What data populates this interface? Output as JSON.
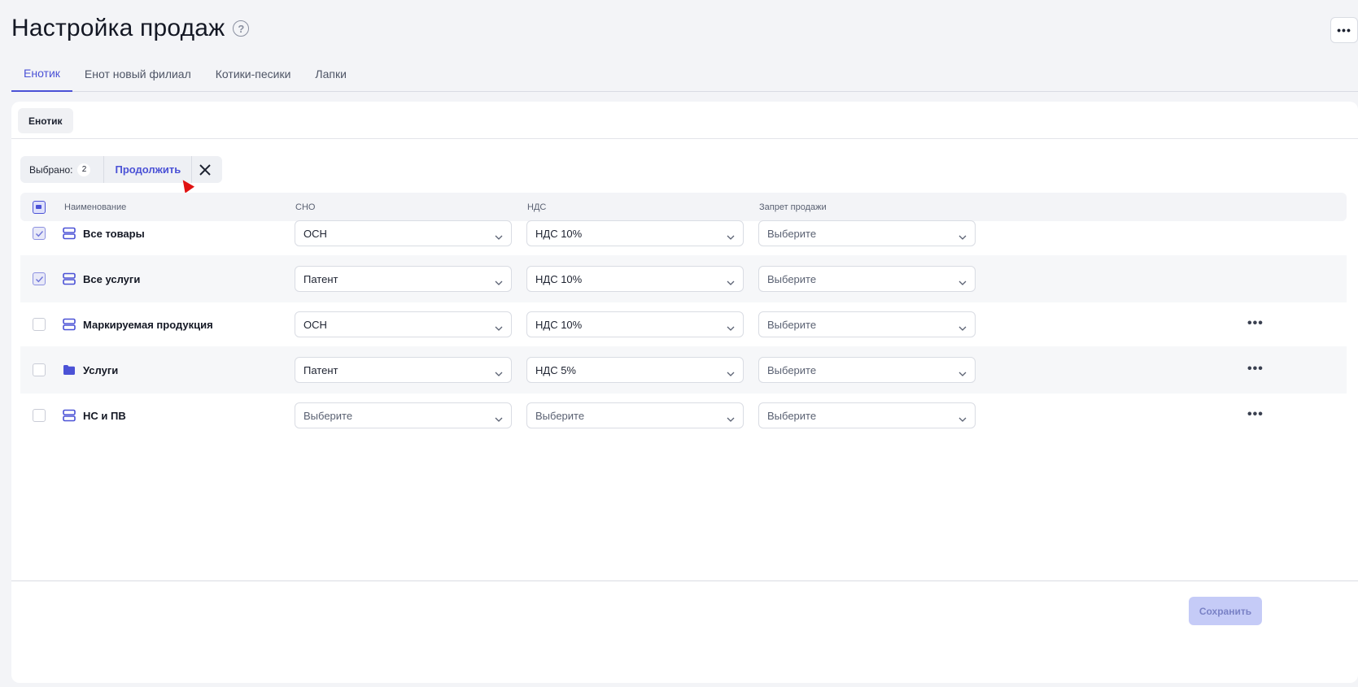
{
  "header": {
    "title": "Настройка продаж"
  },
  "tabs": [
    {
      "label": "Енотик",
      "active": true
    },
    {
      "label": "Енот новый филиал",
      "active": false
    },
    {
      "label": "Котики-песики",
      "active": false
    },
    {
      "label": "Лапки",
      "active": false
    }
  ],
  "branch_chip": "Енотик",
  "selection": {
    "label": "Выбрано:",
    "count": "2",
    "continue_label": "Продолжить"
  },
  "table": {
    "columns": [
      "Наименование",
      "СНО",
      "НДС",
      "Запрет продажи"
    ],
    "rows": [
      {
        "name": "Все товары",
        "icon": "group-icon",
        "checked": true,
        "sno": "ОСН",
        "nds": "НДС 10%",
        "ban": "Выберите",
        "more": false
      },
      {
        "name": "Все услуги",
        "icon": "group-icon",
        "checked": true,
        "sno": "Патент",
        "nds": "НДС 10%",
        "ban": "Выберите",
        "more": false
      },
      {
        "name": "Маркируемая продукция",
        "icon": "group-icon",
        "checked": false,
        "sno": "ОСН",
        "nds": "НДС 10%",
        "ban": "Выберите",
        "more": true
      },
      {
        "name": "Услуги",
        "icon": "folder-icon",
        "checked": false,
        "sno": "Патент",
        "nds": "НДС 5%",
        "ban": "Выберите",
        "more": true
      },
      {
        "name": "НС и ПВ",
        "icon": "group-icon",
        "checked": false,
        "sno": "Выберите",
        "nds": "Выберите",
        "ban": "Выберите",
        "more": true
      }
    ]
  },
  "footer": {
    "save_label": "Сохранить"
  },
  "colors": {
    "accent": "#4b52d6",
    "save_disabled_bg": "#c5cbf7"
  }
}
